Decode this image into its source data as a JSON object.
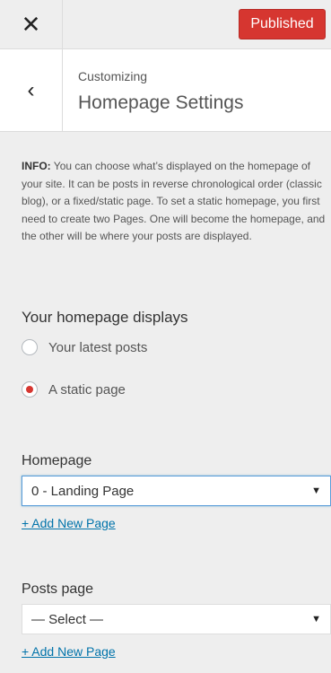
{
  "topbar": {
    "close_icon": "close-icon",
    "publish_label": "Published",
    "publish_color": "#d63630"
  },
  "header": {
    "back_icon": "chevron-left-icon",
    "breadcrumb": "Customizing",
    "title": "Homepage Settings"
  },
  "info": {
    "label": "INFO:",
    "text": " You can choose what’s displayed on the homepage of your site. It can be posts in reverse chronological order (classic blog), or a fixed/static page. To set a static homepage, you first need to create two Pages. One will become the homepage, and the other will be where your posts are displayed."
  },
  "homepage_displays": {
    "title": "Your homepage displays",
    "options": [
      {
        "label": "Your latest posts",
        "checked": false
      },
      {
        "label": "A static page",
        "checked": true
      }
    ]
  },
  "homepage": {
    "label": "Homepage",
    "selected": "0 - Landing Page",
    "add_link": "+ Add New Page"
  },
  "posts_page": {
    "label": "Posts page",
    "selected": "— Select —",
    "add_link": "+ Add New Page"
  }
}
